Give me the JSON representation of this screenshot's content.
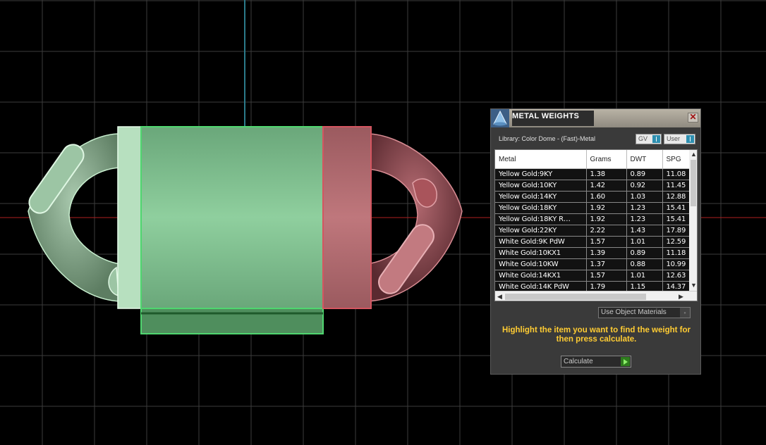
{
  "panel": {
    "title": "METAL WEIGHTS",
    "close_glyph": "✕",
    "library_label": "Library: Color Dome - (Fast)-Metal",
    "toggle_gv": "GV",
    "toggle_user": "User",
    "columns": [
      "Metal",
      "Grams",
      "DWT",
      "SPG"
    ],
    "rows": [
      [
        "Yellow Gold:9KY",
        "1.38",
        "0.89",
        "11.08"
      ],
      [
        "Yellow Gold:10KY",
        "1.42",
        "0.92",
        "11.45"
      ],
      [
        "Yellow Gold:14KY",
        "1.60",
        "1.03",
        "12.88"
      ],
      [
        "Yellow Gold:18KY",
        "1.92",
        "1.23",
        "15.41"
      ],
      [
        "Yellow Gold:18KY R…",
        "1.92",
        "1.23",
        "15.41"
      ],
      [
        "Yellow Gold:22KY",
        "2.22",
        "1.43",
        "17.89"
      ],
      [
        "White Gold:9K PdW",
        "1.57",
        "1.01",
        "12.59"
      ],
      [
        "White Gold:10KX1",
        "1.39",
        "0.89",
        "11.18"
      ],
      [
        "White Gold:10KW",
        "1.37",
        "0.88",
        "10.99"
      ],
      [
        "White Gold:14KX1",
        "1.57",
        "1.01",
        "12.63"
      ],
      [
        "White Gold:14K PdW",
        "1.79",
        "1.15",
        "14.37"
      ]
    ],
    "material_select": "Use Object Materials",
    "instructions": "Highlight the item you want to find the weight for then press calculate.",
    "calculate_label": "Calculate"
  },
  "colors": {
    "grid": "#3c3c3c",
    "axis_x": "#b02020",
    "axis_y": "#2b7a8a",
    "green_object": "#7fc28f",
    "red_object": "#b86a6f",
    "instructions": "#ffcc33"
  },
  "icons": {
    "panel_icon": "cone-icon",
    "close": "close-icon",
    "run": "play-icon"
  }
}
